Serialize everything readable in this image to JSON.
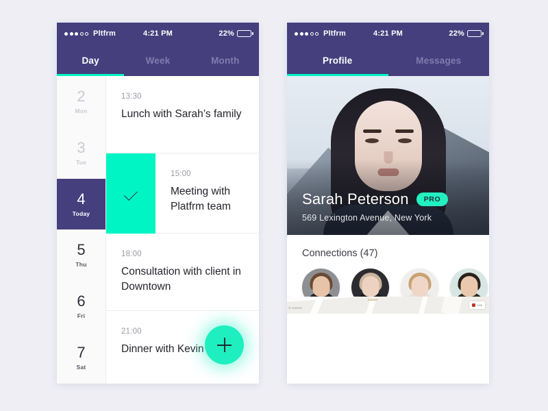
{
  "statusbar": {
    "carrier": "Pltfrm",
    "time": "4:21 PM",
    "battery_pct": "22%",
    "signal_filled": 3,
    "signal_hollow": 2
  },
  "left_phone": {
    "tabs": [
      {
        "label": "Day",
        "active": true
      },
      {
        "label": "Week",
        "active": false
      },
      {
        "label": "Month",
        "active": false
      }
    ],
    "days": [
      {
        "num": "2",
        "name": "Mon",
        "state": "dim"
      },
      {
        "num": "3",
        "name": "Tue",
        "state": "dim"
      },
      {
        "num": "4",
        "name": "Today",
        "state": "today"
      },
      {
        "num": "5",
        "name": "Thu",
        "state": "normal"
      },
      {
        "num": "6",
        "name": "Fri",
        "state": "normal"
      },
      {
        "num": "7",
        "name": "Sat",
        "state": "normal"
      }
    ],
    "events": [
      {
        "time": "13:30",
        "title": "Lunch with Sarah’s family",
        "checked": false
      },
      {
        "time": "15:00",
        "title": "Meeting with Platfrm team",
        "checked": true
      },
      {
        "time": "18:00",
        "title": "Consultation with client in Downtown",
        "checked": false
      },
      {
        "time": "21:00",
        "title": "Dinner with Kevin",
        "checked": false
      }
    ],
    "fab_label": "+"
  },
  "right_phone": {
    "tabs": [
      {
        "label": "Profile",
        "active": true
      },
      {
        "label": "Messages",
        "active": false
      }
    ],
    "profile": {
      "name": "Sarah Peterson",
      "badge": "PRO",
      "address": "569 Lexington Avenue, New York"
    },
    "connections": {
      "title": "Connections (47)",
      "count": 47,
      "avatars": [
        {
          "bg": "#8d8f93",
          "hair": "#6b4a33",
          "skin": "#e7c4a8",
          "body": "#22242a",
          "glasses": false
        },
        {
          "bg": "#2c2b30",
          "hair": "#c9b59b",
          "skin": "#edd2c2",
          "body": "#1c1b20",
          "glasses": false
        },
        {
          "bg": "#efeeec",
          "hair": "#c9a173",
          "skin": "#f0d6c6",
          "body": "#e4e2df",
          "glasses": false
        },
        {
          "bg": "#d7e6e3",
          "hair": "#2b211c",
          "skin": "#e9c8ae",
          "body": "#2f2a26",
          "glasses": false
        },
        {
          "bg": "#4c4f55",
          "hair": "#22201f",
          "skin": "#d9b193",
          "body": "#1a1a1d",
          "glasses": true
        }
      ]
    },
    "map": {
      "street_label": "rk Avenue",
      "chip_label": "Lex"
    }
  },
  "colors": {
    "purple": "#453f7d",
    "teal": "#00f5c4",
    "page_bg": "#eeeef4",
    "card_bg": "#ffffff"
  }
}
